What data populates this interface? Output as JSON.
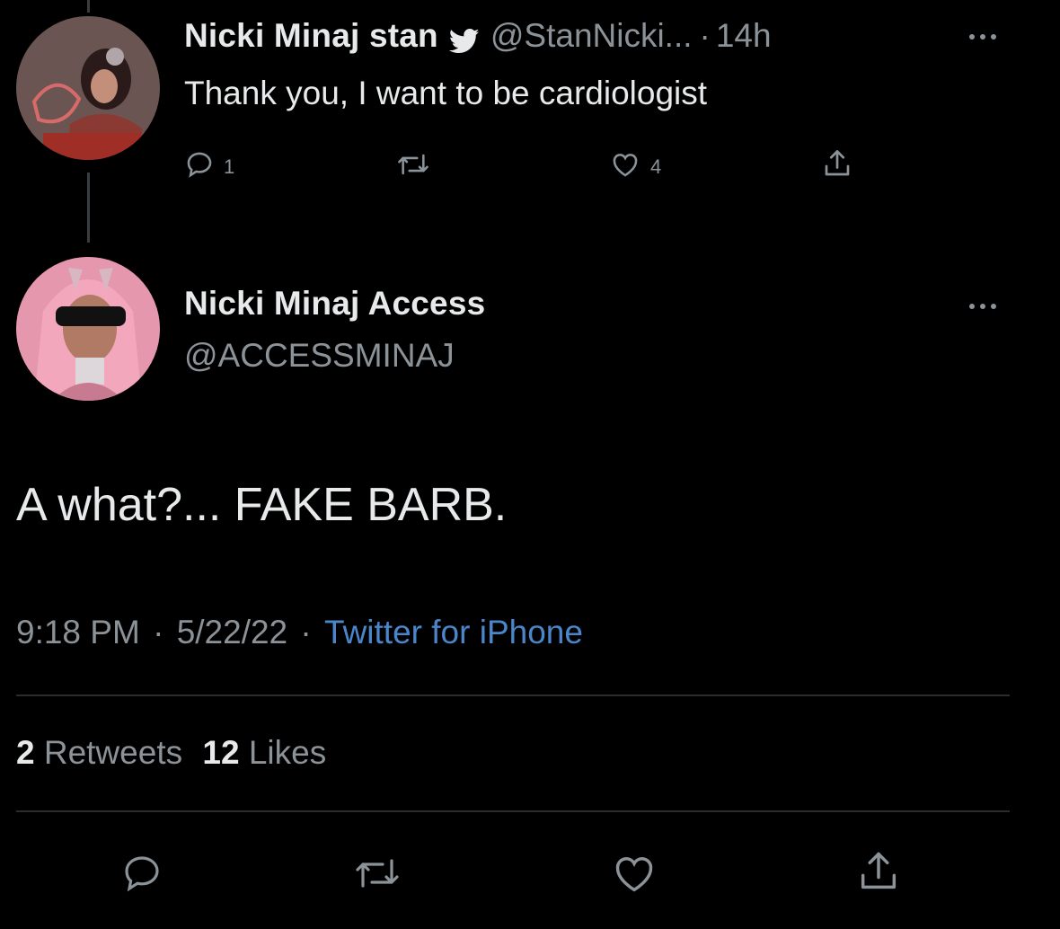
{
  "reply_tweet": {
    "author_name": "Nicki Minaj stan",
    "handle": "@StanNicki...",
    "separator": "·",
    "time": "14h",
    "text": "Thank you, I want to be cardiologist",
    "reply_count": "1",
    "like_count": "4",
    "icons": [
      "twitter-bird-icon",
      "more-icon",
      "reply-icon",
      "retweet-icon",
      "like-icon",
      "share-icon"
    ]
  },
  "main_tweet": {
    "author_name": "Nicki Minaj Access",
    "handle": "@ACCESSMINAJ",
    "text": "A what?... FAKE BARB.",
    "time": "9:18 PM",
    "date": "5/22/22",
    "separator": "·",
    "source": "Twitter for iPhone",
    "retweets_count": "2",
    "retweets_label": "Retweets",
    "likes_count": "12",
    "likes_label": "Likes",
    "icons": [
      "more-icon",
      "reply-icon",
      "retweet-icon",
      "like-icon",
      "share-icon"
    ]
  },
  "colors": {
    "background": "#000000",
    "primary_text": "#e7e9ea",
    "secondary_text": "#8b9298",
    "link": "#1d9bf0",
    "divider": "#2a2d30"
  }
}
